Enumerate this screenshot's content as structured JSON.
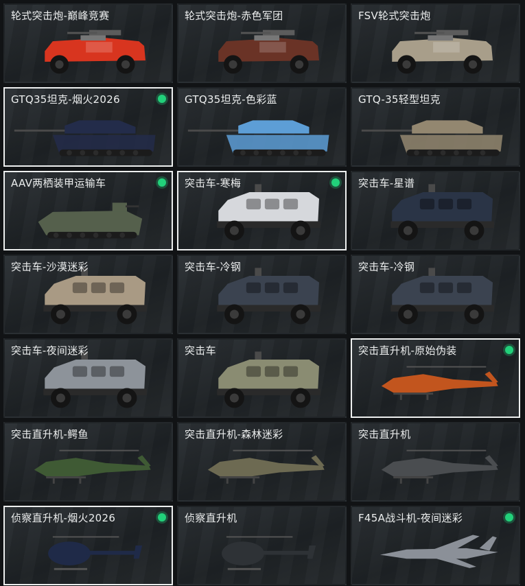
{
  "colors": {
    "background": "#111315",
    "card": "#24282b",
    "selected_border": "#eef0f0",
    "status_dot": "#22d07a"
  },
  "cards": [
    {
      "label": "轮式突击炮-巅峰竞赛",
      "vehicle": "wheeled-assault-gun-icon",
      "selected": false,
      "status": false,
      "paint": "#d8351f"
    },
    {
      "label": "轮式突击炮-赤色军团",
      "vehicle": "wheeled-assault-gun-icon",
      "selected": false,
      "status": false,
      "paint": "#6a3326"
    },
    {
      "label": "FSV轮式突击炮",
      "vehicle": "wheeled-assault-gun-icon",
      "selected": false,
      "status": false,
      "paint": "#a89e8a"
    },
    {
      "label": "GTQ35坦克-烟火2026",
      "vehicle": "tank-icon",
      "selected": true,
      "status": true,
      "paint": "#232c4a"
    },
    {
      "label": "GTQ35坦克-色彩蓝",
      "vehicle": "tank-icon",
      "selected": false,
      "status": false,
      "paint": "#5d9ed6"
    },
    {
      "label": "GTQ-35轻型坦克",
      "vehicle": "tank-icon",
      "selected": false,
      "status": false,
      "paint": "#938770"
    },
    {
      "label": "AAV两栖装甲运输车",
      "vehicle": "amphibious-apc-icon",
      "selected": true,
      "status": true,
      "paint": "#55604c"
    },
    {
      "label": "突击车-寒梅",
      "vehicle": "assault-vehicle-icon",
      "selected": true,
      "status": true,
      "paint": "#d6d8dc"
    },
    {
      "label": "突击车-星谱",
      "vehicle": "assault-vehicle-icon",
      "selected": false,
      "status": false,
      "paint": "#2a3446"
    },
    {
      "label": "突击车-沙漠迷彩",
      "vehicle": "assault-vehicle-icon",
      "selected": false,
      "status": false,
      "paint": "#a99a84"
    },
    {
      "label": "突击车-冷钢",
      "vehicle": "assault-vehicle-icon",
      "selected": false,
      "status": false,
      "paint": "#3b4350"
    },
    {
      "label": "突击车-冷钢",
      "vehicle": "assault-vehicle-icon",
      "selected": false,
      "status": false,
      "paint": "#3b4350"
    },
    {
      "label": "突击车-夜间迷彩",
      "vehicle": "assault-vehicle-icon",
      "selected": false,
      "status": false,
      "paint": "#8d939a"
    },
    {
      "label": "突击车",
      "vehicle": "assault-vehicle-icon",
      "selected": false,
      "status": false,
      "paint": "#8a8c72"
    },
    {
      "label": "突击直升机-原始伪装",
      "vehicle": "attack-helicopter-icon",
      "selected": true,
      "status": true,
      "paint": "#c2551e"
    },
    {
      "label": "突击直升机-鳄鱼",
      "vehicle": "attack-helicopter-icon",
      "selected": false,
      "status": false,
      "paint": "#3f5a34"
    },
    {
      "label": "突击直升机-森林迷彩",
      "vehicle": "attack-helicopter-icon",
      "selected": false,
      "status": false,
      "paint": "#6d6a52"
    },
    {
      "label": "突击直升机",
      "vehicle": "attack-helicopter-icon",
      "selected": false,
      "status": false,
      "paint": "#4a4d50"
    },
    {
      "label": "侦察直升机-烟火2026",
      "vehicle": "scout-helicopter-icon",
      "selected": true,
      "status": true,
      "paint": "#1f2a48"
    },
    {
      "label": "侦察直升机",
      "vehicle": "scout-helicopter-icon",
      "selected": false,
      "status": false,
      "paint": "#2e3236"
    },
    {
      "label": "F45A战斗机-夜间迷彩",
      "vehicle": "fighter-jet-icon",
      "selected": false,
      "status": true,
      "paint": "#8b9098"
    }
  ]
}
